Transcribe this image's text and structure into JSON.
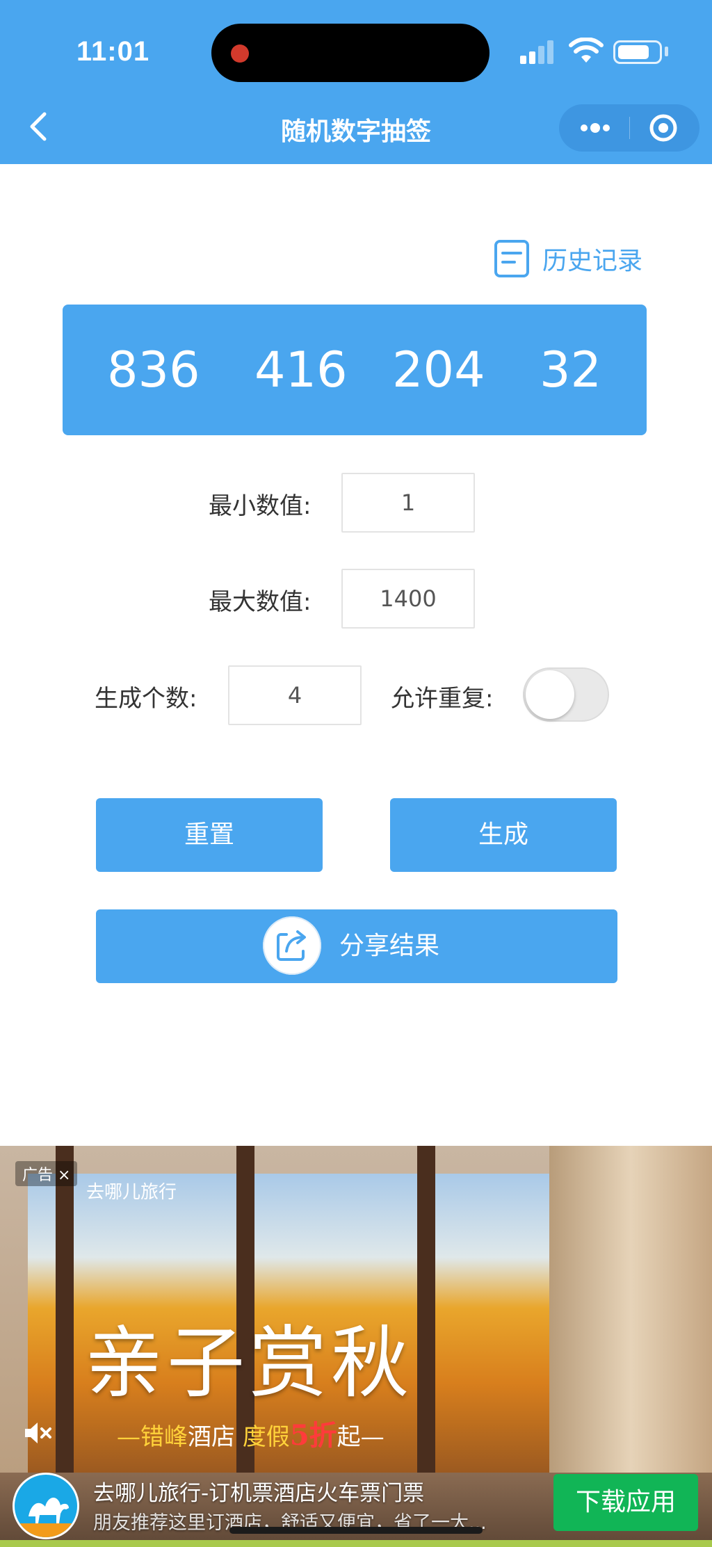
{
  "status_bar": {
    "time": "11:01"
  },
  "nav": {
    "title": "随机数字抽签"
  },
  "history": {
    "label": "历史记录"
  },
  "results": [
    "836",
    "416",
    "204",
    "32"
  ],
  "form": {
    "min_label": "最小数值:",
    "min_value": "1",
    "max_label": "最大数值:",
    "max_value": "1400",
    "count_label": "生成个数:",
    "count_value": "4",
    "repeat_label": "允许重复:",
    "repeat_enabled": false
  },
  "buttons": {
    "reset": "重置",
    "generate": "生成",
    "share": "分享结果"
  },
  "ad": {
    "tag": "广告",
    "brand_top": "去哪儿旅行",
    "headline": "亲子赏秋",
    "sub_a": "—错峰",
    "sub_b": "酒店",
    "sub_c": "度假",
    "sub_d": "5折",
    "sub_e": "起—",
    "title": "去哪儿旅行-订机票酒店火车票门票",
    "desc": "朋友推荐这里订酒店，舒适又便宜，省了一大...",
    "cta": "下载应用"
  },
  "colors": {
    "accent": "#4aa6ef",
    "cta": "#11b556"
  }
}
